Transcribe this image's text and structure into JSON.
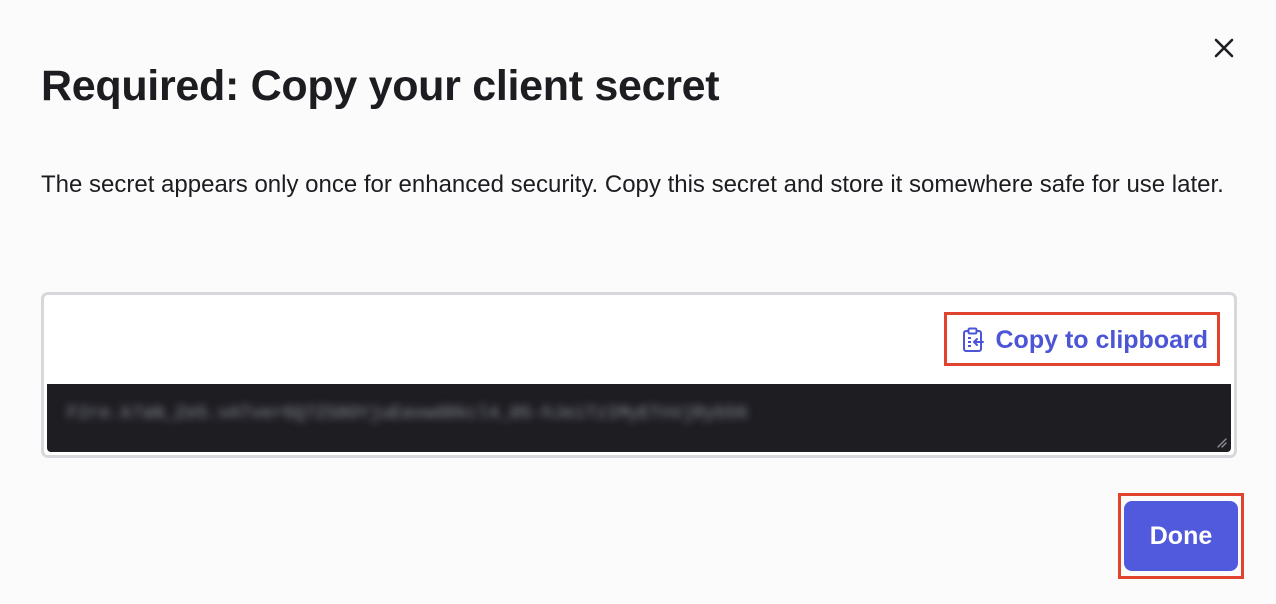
{
  "dialog": {
    "title": "Required: Copy your client secret",
    "description": "The secret appears only once for enhanced security. Copy this secret and store it somewhere safe for use later.",
    "close_icon": "close-icon"
  },
  "secret": {
    "copy_label": "Copy to clipboard",
    "copy_icon": "clipboard-icon",
    "value": "F2re.k7aN_Ze5.vATver6Q7ZS8OYjuEavwd8kcl4_05-hJeiTzIMyETnVjRyb56"
  },
  "actions": {
    "done_label": "Done"
  },
  "colors": {
    "accent": "#5159dc",
    "link": "#4c55d6",
    "highlight": "#e0442e",
    "secret_bg": "#1d1d22"
  }
}
